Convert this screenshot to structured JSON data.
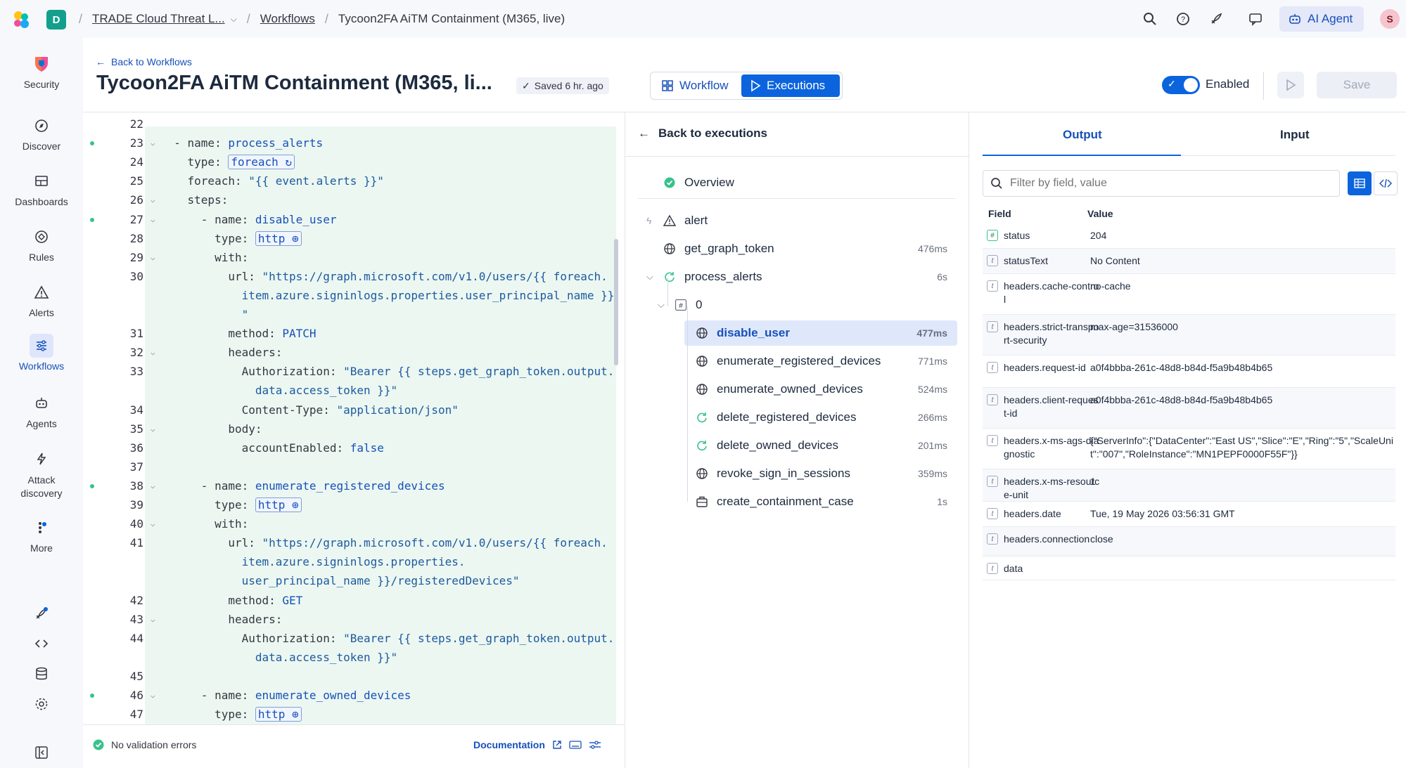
{
  "topbar": {
    "space_initial": "D",
    "breadcrumb_space": "TRADE Cloud Threat L...",
    "breadcrumb_workflows": "Workflows",
    "breadcrumb_current": "Tycoon2FA AiTM Containment (M365, live)",
    "ai_agent_label": "AI Agent",
    "avatar_initial": "S"
  },
  "nav": {
    "items": [
      {
        "label": "Security",
        "icon": "security-logo-icon"
      },
      {
        "label": "Discover",
        "icon": "compass-icon"
      },
      {
        "label": "Dashboards",
        "icon": "dashboard-icon"
      },
      {
        "label": "Rules",
        "icon": "rules-icon"
      },
      {
        "label": "Alerts",
        "icon": "warning-icon"
      },
      {
        "label": "Workflows",
        "icon": "workflow-icon"
      },
      {
        "label": "Agents",
        "icon": "robot-icon"
      },
      {
        "label": "Attack discovery",
        "icon": "lightning-icon"
      },
      {
        "label": "More",
        "icon": "more-icon"
      }
    ]
  },
  "header": {
    "back_label": "Back to Workflows",
    "title": "Tycoon2FA AiTM Containment (M365, li...",
    "saved_label": "Saved 6 hr. ago",
    "tab_workflow": "Workflow",
    "tab_executions": "Executions",
    "enabled_label": "Enabled",
    "save_label": "Save"
  },
  "editor": {
    "lines": [
      {
        "n": "22",
        "dot": false,
        "fold": false,
        "html": ""
      },
      {
        "n": "23",
        "dot": true,
        "fold": true,
        "html": "  <span class='k'>- name</span>: <span class='v'>process_alerts</span>"
      },
      {
        "n": "24",
        "dot": false,
        "fold": false,
        "html": "    <span class='k'>type</span>: <span class='chip'>foreach ↻</span>"
      },
      {
        "n": "25",
        "dot": false,
        "fold": false,
        "html": "    <span class='k'>foreach</span>: <span class='s'>\"{{ event.alerts }}\"</span>"
      },
      {
        "n": "26",
        "dot": false,
        "fold": true,
        "html": "    <span class='k'>steps</span>:"
      },
      {
        "n": "27",
        "dot": true,
        "fold": true,
        "html": "      <span class='k'>- name</span>: <span class='v'>disable_user</span>"
      },
      {
        "n": "28",
        "dot": false,
        "fold": false,
        "html": "        <span class='k'>type</span>: <span class='chip'>http ⊕</span>"
      },
      {
        "n": "29",
        "dot": false,
        "fold": true,
        "html": "        <span class='k'>with</span>:"
      },
      {
        "n": "30",
        "dot": false,
        "fold": false,
        "html": "          <span class='k'>url</span>: <span class='s'>\"https://graph.microsoft.com/v1.0/users/{{ foreach.</span>"
      },
      {
        "n": "",
        "dot": false,
        "fold": false,
        "html": "            <span class='s'>item.azure.signinlogs.properties.user_principal_name }}</span>"
      },
      {
        "n": "",
        "dot": false,
        "fold": false,
        "html": "            <span class='s'>\"</span>"
      },
      {
        "n": "31",
        "dot": false,
        "fold": false,
        "html": "          <span class='k'>method</span>: <span class='v'>PATCH</span>"
      },
      {
        "n": "32",
        "dot": false,
        "fold": true,
        "html": "          <span class='k'>headers</span>:"
      },
      {
        "n": "33",
        "dot": false,
        "fold": false,
        "html": "            <span class='k'>Authorization</span>: <span class='s'>\"Bearer {{ steps.get_graph_token.output.</span>"
      },
      {
        "n": "",
        "dot": false,
        "fold": false,
        "html": "              <span class='s'>data.access_token }}\"</span>"
      },
      {
        "n": "34",
        "dot": false,
        "fold": false,
        "html": "            <span class='k'>Content-Type</span>: <span class='s'>\"application/json\"</span>"
      },
      {
        "n": "35",
        "dot": false,
        "fold": true,
        "html": "          <span class='k'>body</span>:"
      },
      {
        "n": "36",
        "dot": false,
        "fold": false,
        "html": "            <span class='k'>accountEnabled</span>: <span class='v'>false</span>"
      },
      {
        "n": "37",
        "dot": false,
        "fold": false,
        "html": ""
      },
      {
        "n": "38",
        "dot": true,
        "fold": true,
        "html": "      <span class='k'>- name</span>: <span class='v'>enumerate_registered_devices</span>"
      },
      {
        "n": "39",
        "dot": false,
        "fold": false,
        "html": "        <span class='k'>type</span>: <span class='chip'>http ⊕</span>"
      },
      {
        "n": "40",
        "dot": false,
        "fold": true,
        "html": "        <span class='k'>with</span>:"
      },
      {
        "n": "41",
        "dot": false,
        "fold": false,
        "html": "          <span class='k'>url</span>: <span class='s'>\"https://graph.microsoft.com/v1.0/users/{{ foreach.</span>"
      },
      {
        "n": "",
        "dot": false,
        "fold": false,
        "html": "            <span class='s'>item.azure.signinlogs.properties.</span>"
      },
      {
        "n": "",
        "dot": false,
        "fold": false,
        "html": "            <span class='s'>user_principal_name }}/registeredDevices\"</span>"
      },
      {
        "n": "42",
        "dot": false,
        "fold": false,
        "html": "          <span class='k'>method</span>: <span class='v'>GET</span>"
      },
      {
        "n": "43",
        "dot": false,
        "fold": true,
        "html": "          <span class='k'>headers</span>:"
      },
      {
        "n": "44",
        "dot": false,
        "fold": false,
        "html": "            <span class='k'>Authorization</span>: <span class='s'>\"Bearer {{ steps.get_graph_token.output.</span>"
      },
      {
        "n": "",
        "dot": false,
        "fold": false,
        "html": "              <span class='s'>data.access_token }}\"</span>"
      },
      {
        "n": "45",
        "dot": false,
        "fold": false,
        "html": ""
      },
      {
        "n": "46",
        "dot": true,
        "fold": true,
        "html": "      <span class='k'>- name</span>: <span class='v'>enumerate_owned_devices</span>"
      },
      {
        "n": "47",
        "dot": false,
        "fold": false,
        "html": "        <span class='k'>type</span>: <span class='chip'>http ⊕</span>"
      }
    ],
    "footer_status": "No validation errors",
    "footer_doc": "Documentation"
  },
  "executions": {
    "back_label": "Back to executions",
    "overview_label": "Overview",
    "steps": [
      {
        "name": "alert",
        "duration": "",
        "icon": "warning-icon",
        "indent": 0
      },
      {
        "name": "get_graph_token",
        "duration": "476ms",
        "icon": "globe-icon",
        "indent": 0
      },
      {
        "name": "process_alerts",
        "duration": "6s",
        "icon": "loop-icon",
        "indent": 0
      },
      {
        "name": "0",
        "duration": "",
        "icon": "hash-icon",
        "indent": 1
      },
      {
        "name": "disable_user",
        "duration": "477ms",
        "icon": "globe-icon",
        "indent": 2,
        "selected": true
      },
      {
        "name": "enumerate_registered_devices",
        "duration": "771ms",
        "icon": "globe-icon",
        "indent": 2
      },
      {
        "name": "enumerate_owned_devices",
        "duration": "524ms",
        "icon": "globe-icon",
        "indent": 2
      },
      {
        "name": "delete_registered_devices",
        "duration": "266ms",
        "icon": "loop-icon",
        "indent": 2
      },
      {
        "name": "delete_owned_devices",
        "duration": "201ms",
        "icon": "loop-icon",
        "indent": 2
      },
      {
        "name": "revoke_sign_in_sessions",
        "duration": "359ms",
        "icon": "globe-icon",
        "indent": 2
      },
      {
        "name": "create_containment_case",
        "duration": "1s",
        "icon": "case-icon",
        "indent": 2
      }
    ]
  },
  "output": {
    "tab_output": "Output",
    "tab_input": "Input",
    "filter_placeholder": "Filter by field, value",
    "col_field": "Field",
    "col_value": "Value",
    "rows": [
      {
        "type": "#",
        "field": "status",
        "value": "204"
      },
      {
        "type": "t",
        "field": "statusText",
        "value": "No Content"
      },
      {
        "type": "t",
        "field": "headers.cache-control",
        "value": "no-cache"
      },
      {
        "type": "t",
        "field": "headers.strict-transport-security",
        "value": "max-age=31536000"
      },
      {
        "type": "t",
        "field": "headers.request-id",
        "value": "a0f4bbba-261c-48d8-b84d-f5a9b48b4b65"
      },
      {
        "type": "t",
        "field": "headers.client-request-id",
        "value": "a0f4bbba-261c-48d8-b84d-f5a9b48b4b65"
      },
      {
        "type": "t",
        "field": "headers.x-ms-ags-diagnostic",
        "value": "{\"ServerInfo\":{\"DataCenter\":\"East US\",\"Slice\":\"E\",\"Ring\":\"5\",\"ScaleUnit\":\"007\",\"RoleInstance\":\"MN1PEPF0000F55F\"}}"
      },
      {
        "type": "t",
        "field": "headers.x-ms-resource-unit",
        "value": "1"
      },
      {
        "type": "t",
        "field": "headers.date",
        "value": "Tue, 19 May 2026 03:56:31 GMT"
      },
      {
        "type": "t",
        "field": "headers.connection",
        "value": "close"
      },
      {
        "type": "t",
        "field": "data",
        "value": ""
      }
    ]
  },
  "colors": {
    "accent": "#0b64dd",
    "success": "#37c28e",
    "editor_bg": "#ecf7f1"
  }
}
